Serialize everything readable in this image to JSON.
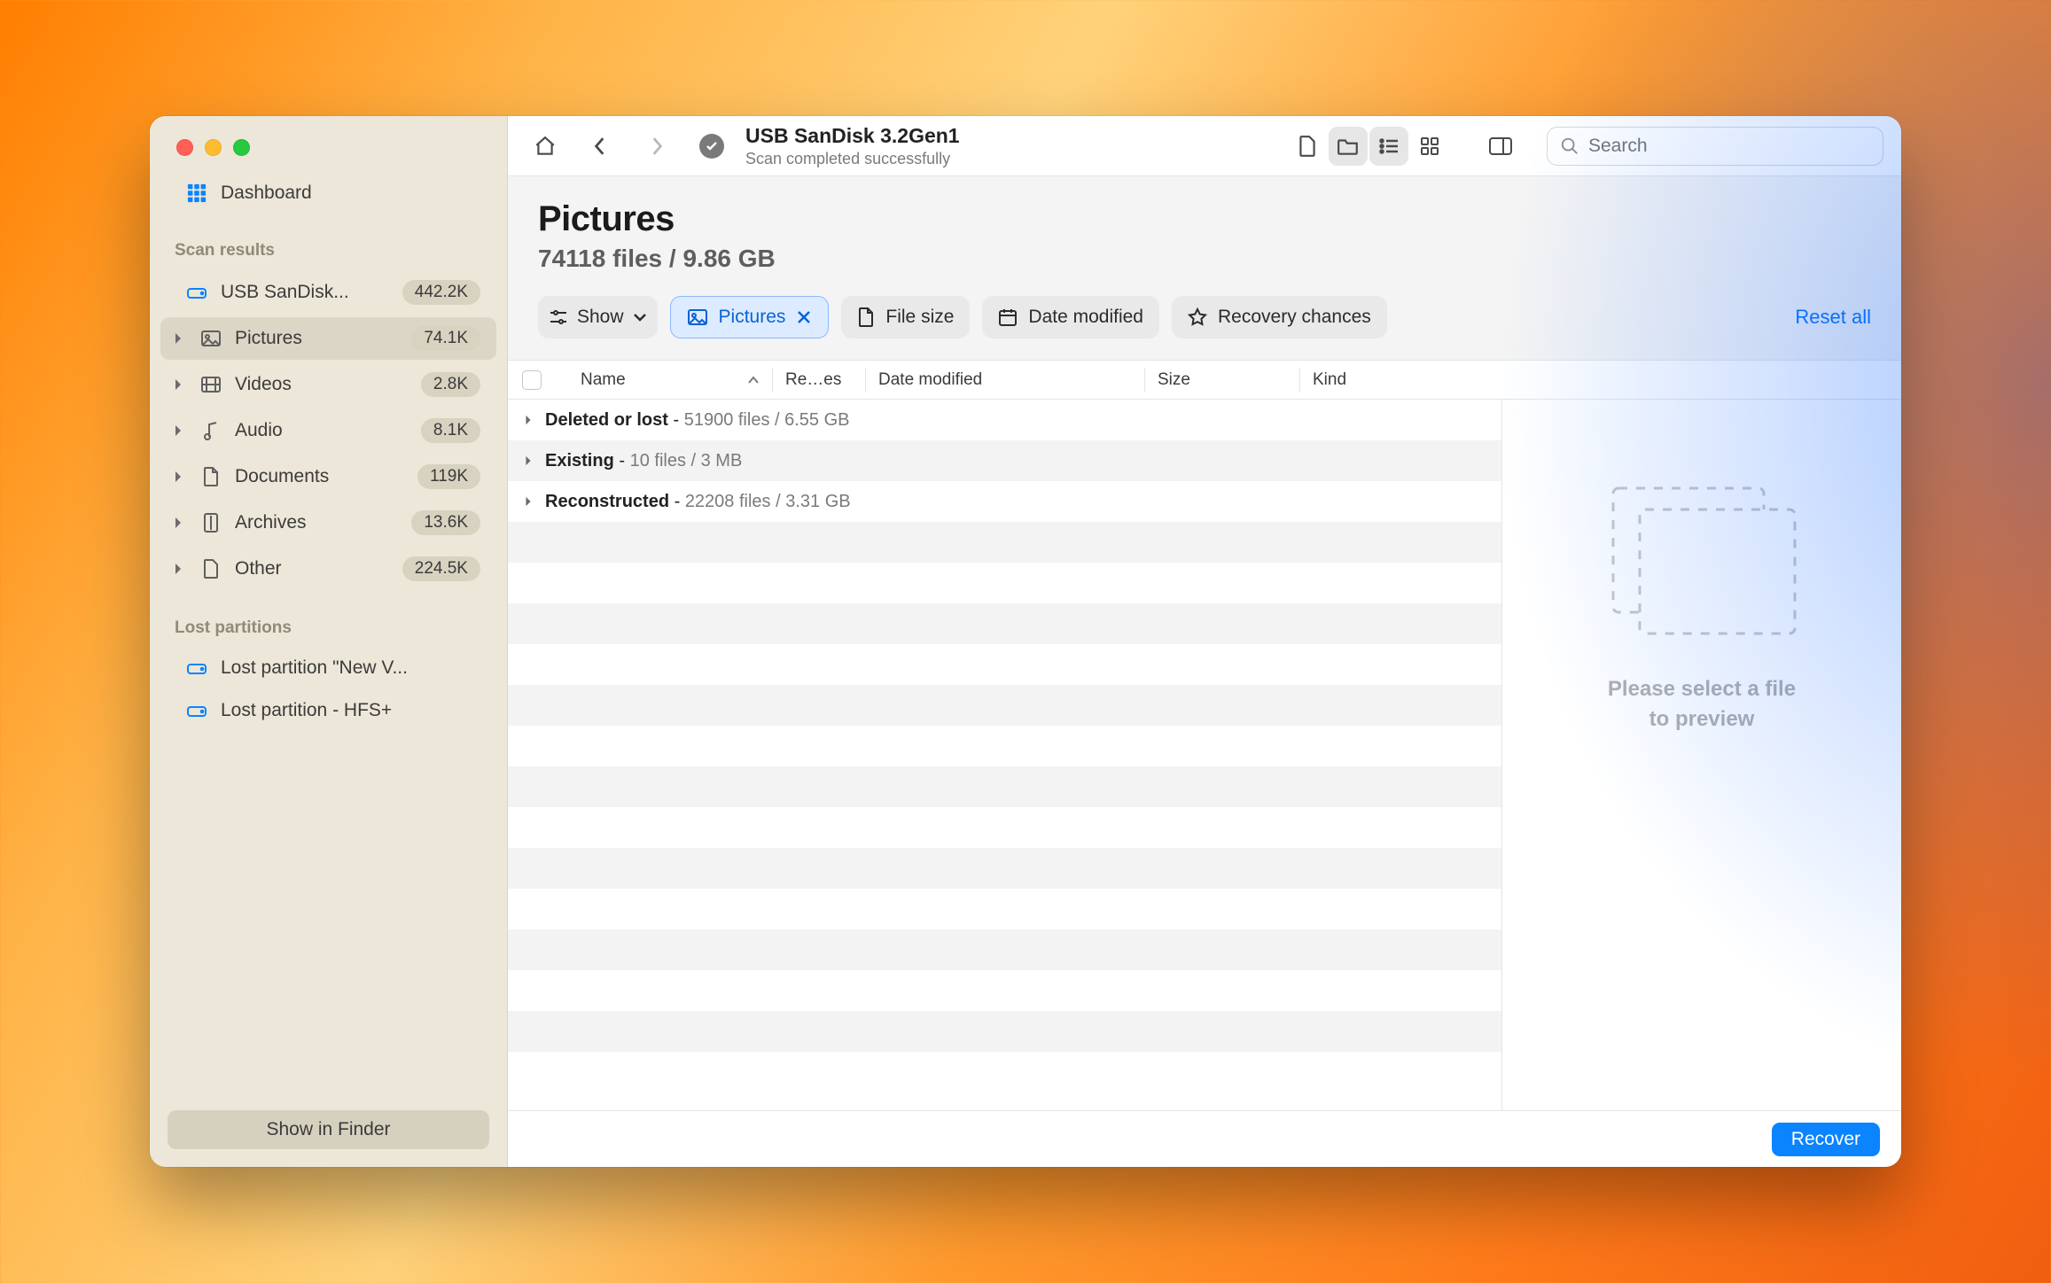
{
  "sidebar": {
    "dashboard": "Dashboard",
    "scan_results_caption": "Scan results",
    "drive": {
      "label": "USB  SanDisk...",
      "badge": "442.2K"
    },
    "categories": [
      {
        "key": "pictures",
        "label": "Pictures",
        "badge": "74.1K",
        "active": true
      },
      {
        "key": "videos",
        "label": "Videos",
        "badge": "2.8K",
        "active": false
      },
      {
        "key": "audio",
        "label": "Audio",
        "badge": "8.1K",
        "active": false
      },
      {
        "key": "documents",
        "label": "Documents",
        "badge": "119K",
        "active": false
      },
      {
        "key": "archives",
        "label": "Archives",
        "badge": "13.6K",
        "active": false
      },
      {
        "key": "other",
        "label": "Other",
        "badge": "224.5K",
        "active": false
      }
    ],
    "lost_partitions_caption": "Lost partitions",
    "lost_partitions": [
      {
        "label": "Lost partition \"New V..."
      },
      {
        "label": "Lost partition - HFS+"
      }
    ],
    "show_in_finder": "Show in Finder"
  },
  "toolbar": {
    "drive_title": "USB  SanDisk 3.2Gen1",
    "scan_status": "Scan completed successfully",
    "search_placeholder": "Search"
  },
  "header": {
    "title": "Pictures",
    "subtitle": "74118 files / 9.86 GB"
  },
  "filters": {
    "show": "Show",
    "pictures": "Pictures",
    "file_size": "File size",
    "date_modified": "Date modified",
    "recovery_chances": "Recovery chances",
    "reset": "Reset all"
  },
  "columns": {
    "name": "Name",
    "re": "Re…es",
    "date": "Date modified",
    "size": "Size",
    "kind": "Kind"
  },
  "groups": [
    {
      "label": "Deleted or lost",
      "details": "51900 files / 6.55 GB"
    },
    {
      "label": "Existing",
      "details": "10 files / 3 MB"
    },
    {
      "label": "Reconstructed",
      "details": "22208 files / 3.31 GB"
    }
  ],
  "preview": {
    "line1": "Please select a file",
    "line2": "to preview"
  },
  "footer": {
    "recover": "Recover"
  }
}
